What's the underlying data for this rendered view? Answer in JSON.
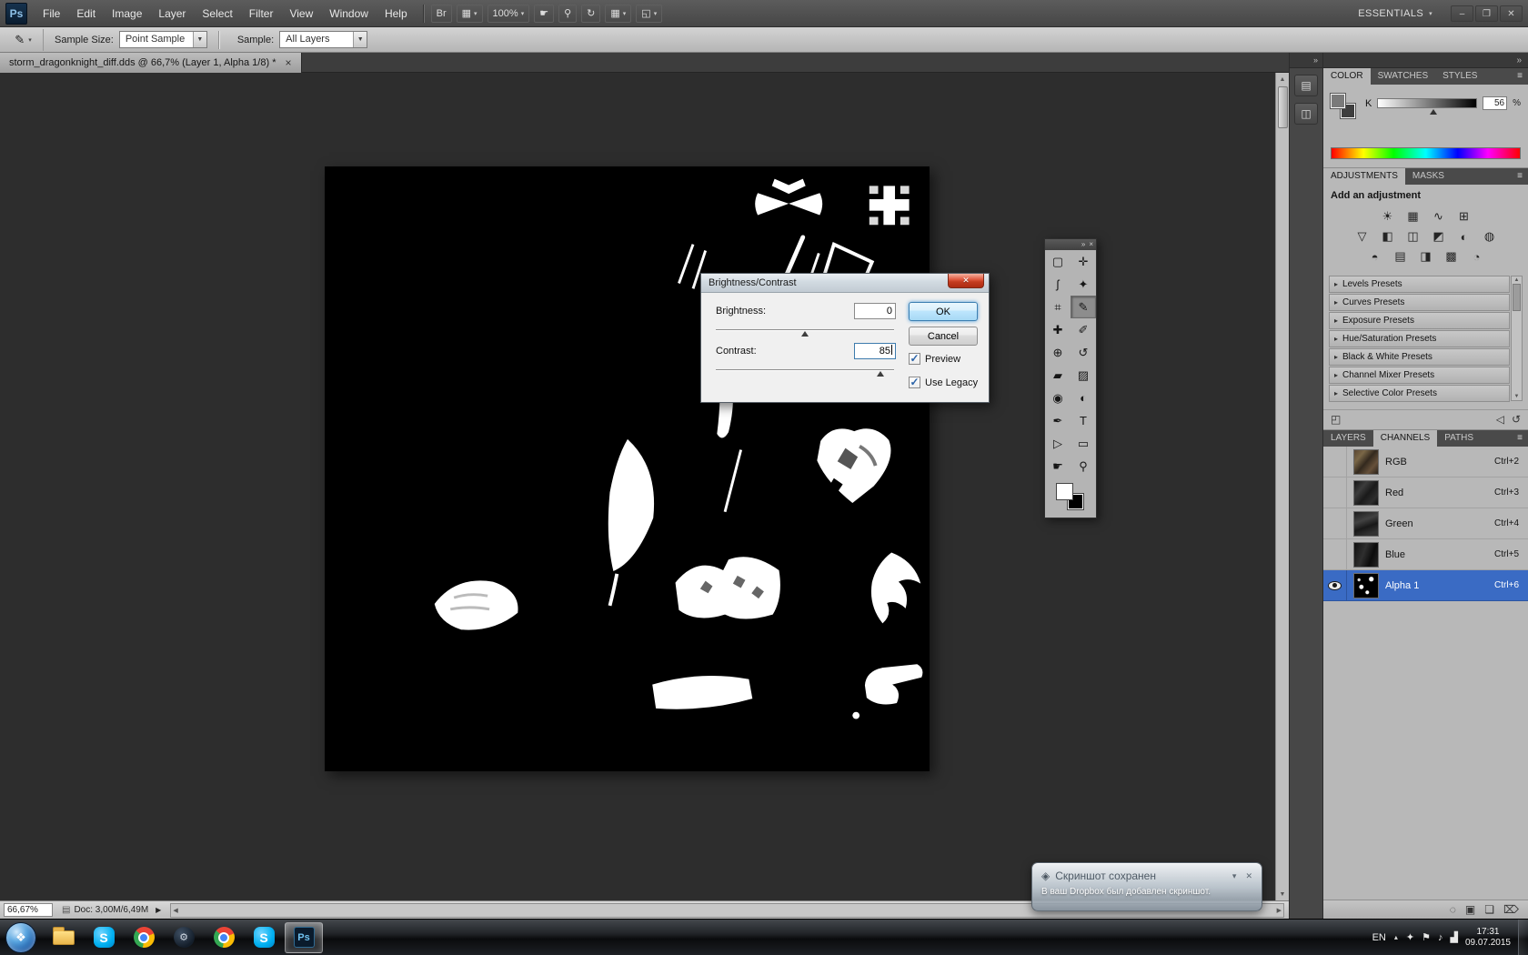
{
  "colors": {
    "selection_blue": "#3a6bc4",
    "close_red": "#c33b1f",
    "panel_gray": "#b8b8b8"
  },
  "glyphs": {
    "dropdown": "▾",
    "panel_menu": "≡",
    "up": "▲",
    "down": "▼",
    "left": "◀",
    "right": "▶",
    "page": "▤",
    "check": "✓"
  },
  "menubar": {
    "logo": "Ps",
    "items": [
      "File",
      "Edit",
      "Image",
      "Layer",
      "Select",
      "Filter",
      "View",
      "Window",
      "Help"
    ],
    "app_buttons": [
      {
        "name": "launch-bridge-button",
        "label": "Br",
        "arrow": false
      },
      {
        "name": "view-extras-button",
        "glyph": "▦",
        "arrow": true
      },
      {
        "name": "zoom-level-dropdown",
        "label": "100%",
        "arrow": true
      },
      {
        "name": "hand-tool-button",
        "glyph": "☛",
        "arrow": false
      },
      {
        "name": "zoom-tool-button",
        "glyph": "⚲",
        "arrow": false
      },
      {
        "name": "rotate-view-button",
        "glyph": "↻",
        "arrow": false
      },
      {
        "name": "arrange-documents-button",
        "glyph": "▦",
        "arrow": true
      },
      {
        "name": "screen-mode-button",
        "glyph": "◱",
        "arrow": true
      }
    ],
    "workspace": "ESSENTIALS",
    "window_controls": [
      {
        "name": "minimize-button",
        "glyph": "–"
      },
      {
        "name": "restore-button",
        "glyph": "❐"
      },
      {
        "name": "close-button",
        "glyph": "✕"
      }
    ]
  },
  "options_bar": {
    "tool_glyph": "✎",
    "sample_size_label": "Sample Size:",
    "sample_size_value": "Point Sample",
    "sample_label": "Sample:",
    "sample_value": "All Layers"
  },
  "document_tab": {
    "title": "storm_dragonknight_diff.dds @ 66,7% (Layer 1, Alpha 1/8) *",
    "close_glyph": "×"
  },
  "dialog": {
    "title": "Brightness/Contrast",
    "close_glyph": "✕",
    "brightness_label": "Brightness:",
    "brightness_value": "0",
    "brightness_slider_pos": 0.5,
    "contrast_label": "Contrast:",
    "contrast_value": "85",
    "contrast_slider_pos": 0.925,
    "ok_label": "OK",
    "cancel_label": "Cancel",
    "preview_label": "Preview",
    "preview_checked": true,
    "use_legacy_label": "Use Legacy",
    "use_legacy_checked": true
  },
  "tools_panel": {
    "collapse_glyph": "»",
    "close_glyph": "×",
    "tools": [
      {
        "name": "rectangular-marquee-tool",
        "glyph": "▢"
      },
      {
        "name": "move-tool",
        "glyph": "✛"
      },
      {
        "name": "lasso-tool",
        "glyph": "ʃ"
      },
      {
        "name": "quick-selection-tool",
        "glyph": "✦"
      },
      {
        "name": "crop-tool",
        "glyph": "⌗"
      },
      {
        "name": "eyedropper-tool",
        "glyph": "✎",
        "selected": true
      },
      {
        "name": "healing-brush-tool",
        "glyph": "✚"
      },
      {
        "name": "brush-tool",
        "glyph": "✐"
      },
      {
        "name": "clone-stamp-tool",
        "glyph": "⊕"
      },
      {
        "name": "history-brush-tool",
        "glyph": "↺"
      },
      {
        "name": "eraser-tool",
        "glyph": "▰"
      },
      {
        "name": "gradient-tool",
        "glyph": "▨"
      },
      {
        "name": "blur-tool",
        "glyph": "◉"
      },
      {
        "name": "dodge-tool",
        "glyph": "◐"
      },
      {
        "name": "pen-tool",
        "glyph": "✒"
      },
      {
        "name": "type-tool",
        "glyph": "T"
      },
      {
        "name": "path-selection-tool",
        "glyph": "▷"
      },
      {
        "name": "shape-tool",
        "glyph": "▭"
      },
      {
        "name": "hand-tool",
        "glyph": "☛"
      },
      {
        "name": "zoom-tool",
        "glyph": "⚲"
      }
    ]
  },
  "dock": {
    "collapse_glyph": "»",
    "strip_collapse_glyph": "»",
    "strip_icons": [
      {
        "name": "collapsed-panel-icon-1",
        "glyph": "▤"
      },
      {
        "name": "collapsed-panel-icon-2",
        "glyph": "◫"
      }
    ]
  },
  "color_panel": {
    "tabs": [
      "COLOR",
      "SWATCHES",
      "STYLES"
    ],
    "active_tab": "COLOR",
    "channel_label": "K",
    "value": "56",
    "unit": "%",
    "slider_pos": 0.56
  },
  "adjustments_panel": {
    "tabs": [
      "ADJUSTMENTS",
      "MASKS"
    ],
    "active_tab": "ADJUSTMENTS",
    "heading": "Add an adjustment",
    "icon_rows": [
      [
        {
          "name": "brightness-contrast-adjustment-icon",
          "glyph": "☀"
        },
        {
          "name": "levels-adjustment-icon",
          "glyph": "▦"
        },
        {
          "name": "curves-adjustment-icon",
          "glyph": "∿"
        },
        {
          "name": "exposure-adjustment-icon",
          "glyph": "⊞"
        }
      ],
      [
        {
          "name": "vibrance-adjustment-icon",
          "glyph": "▽"
        },
        {
          "name": "hue-saturation-adjustment-icon",
          "glyph": "◧"
        },
        {
          "name": "color-balance-adjustment-icon",
          "glyph": "◫"
        },
        {
          "name": "black-white-adjustment-icon",
          "glyph": "◩"
        },
        {
          "name": "photo-filter-adjustment-icon",
          "glyph": "◐"
        },
        {
          "name": "channel-mixer-adjustment-icon",
          "glyph": "◍"
        }
      ],
      [
        {
          "name": "invert-adjustment-icon",
          "glyph": "◓"
        },
        {
          "name": "posterize-adjustment-icon",
          "glyph": "▤"
        },
        {
          "name": "threshold-adjustment-icon",
          "glyph": "◨"
        },
        {
          "name": "gradient-map-adjustment-icon",
          "glyph": "▩"
        },
        {
          "name": "selective-color-adjustment-icon",
          "glyph": "◔"
        }
      ]
    ],
    "presets": [
      "Levels Presets",
      "Curves Presets",
      "Exposure Presets",
      "Hue/Saturation Presets",
      "Black & White Presets",
      "Channel Mixer Presets",
      "Selective Color Presets"
    ],
    "preset_arrow": "▸",
    "footer_left": [
      {
        "name": "switch-panel-view-button",
        "glyph": "◰"
      }
    ],
    "footer_right": [
      {
        "name": "previous-state-button",
        "glyph": "◁"
      },
      {
        "name": "reset-button",
        "glyph": "↺"
      }
    ]
  },
  "channels_panel": {
    "tabs": [
      "LAYERS",
      "CHANNELS",
      "PATHS"
    ],
    "active_tab": "CHANNELS",
    "channels": [
      {
        "name": "RGB",
        "shortcut": "Ctrl+2",
        "thumb": "rgb",
        "visible": false,
        "selected": false
      },
      {
        "name": "Red",
        "shortcut": "Ctrl+3",
        "thumb": "red",
        "visible": false,
        "selected": false
      },
      {
        "name": "Green",
        "shortcut": "Ctrl+4",
        "thumb": "green",
        "visible": false,
        "selected": false
      },
      {
        "name": "Blue",
        "shortcut": "Ctrl+5",
        "thumb": "blue",
        "visible": false,
        "selected": false
      },
      {
        "name": "Alpha 1",
        "shortcut": "Ctrl+6",
        "thumb": "alpha",
        "visible": true,
        "selected": true
      }
    ],
    "footer_icons": [
      {
        "name": "load-channel-as-selection-button",
        "glyph": "◌"
      },
      {
        "name": "save-selection-as-channel-button",
        "glyph": "▣"
      },
      {
        "name": "new-channel-button",
        "glyph": "❏"
      },
      {
        "name": "delete-channel-button",
        "glyph": "⌦"
      }
    ]
  },
  "status_bar": {
    "zoom": "66,67%",
    "doc_info": "Doc: 3,00M/6,49M",
    "flyout_glyph": "▶"
  },
  "notification": {
    "icon_glyph": "◈",
    "title": "Скриншот сохранен",
    "body": "В ваш Dropbox был добавлен скриншот.",
    "menu_glyph": "▾",
    "close_glyph": "✕"
  },
  "taskbar": {
    "start_glyph": "❖",
    "icons": [
      {
        "name": "explorer",
        "kind": "folder"
      },
      {
        "name": "skype",
        "kind": "skype",
        "label": "S"
      },
      {
        "name": "chrome",
        "kind": "chrome"
      },
      {
        "name": "steam",
        "kind": "steam",
        "label": "⚙"
      },
      {
        "name": "chrome-2",
        "kind": "chrome"
      },
      {
        "name": "skype-2",
        "kind": "skype",
        "label": "S"
      },
      {
        "name": "photoshop",
        "kind": "ps",
        "label": "Ps",
        "active": true
      }
    ],
    "language": "EN",
    "tray_chevron": "▴",
    "tray_icons": [
      {
        "name": "tray-dropbox-icon",
        "glyph": "✦"
      },
      {
        "name": "tray-action-center-icon",
        "glyph": "⚑"
      },
      {
        "name": "tray-volume-icon",
        "glyph": "♪"
      },
      {
        "name": "tray-network-icon",
        "glyph": "▟"
      }
    ],
    "time": "17:31",
    "date": "09.07.2015"
  }
}
